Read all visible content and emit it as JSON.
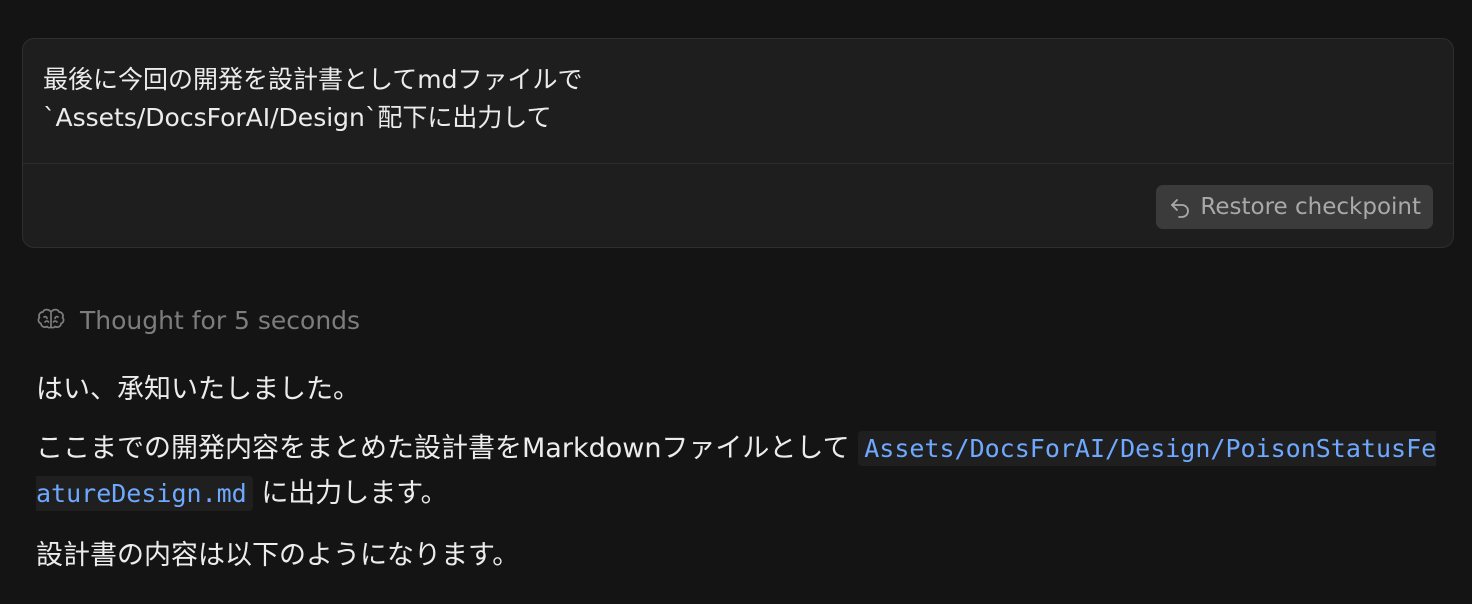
{
  "user_message": {
    "text": "最後に今回の開発を設計書としてmdファイルで\n`Assets/DocsForAI/Design`配下に出力して",
    "restore_label": "Restore checkpoint"
  },
  "thought": {
    "label": "Thought for 5 seconds"
  },
  "assistant": {
    "para1": "はい、承知いたしました。",
    "para2_before": "ここまでの開発内容をまとめた設計書をMarkdownファイルとして",
    "para2_code": "Assets/DocsForAI/Design/PoisonStatusFeatureDesign.md",
    "para2_after": "に出力します。",
    "para3": "設計書の内容は以下のようになります。"
  },
  "colors": {
    "background": "#141414",
    "card": "#1e1e1e",
    "code_text": "#6fa8ff",
    "muted_text": "#7d7d7d"
  }
}
